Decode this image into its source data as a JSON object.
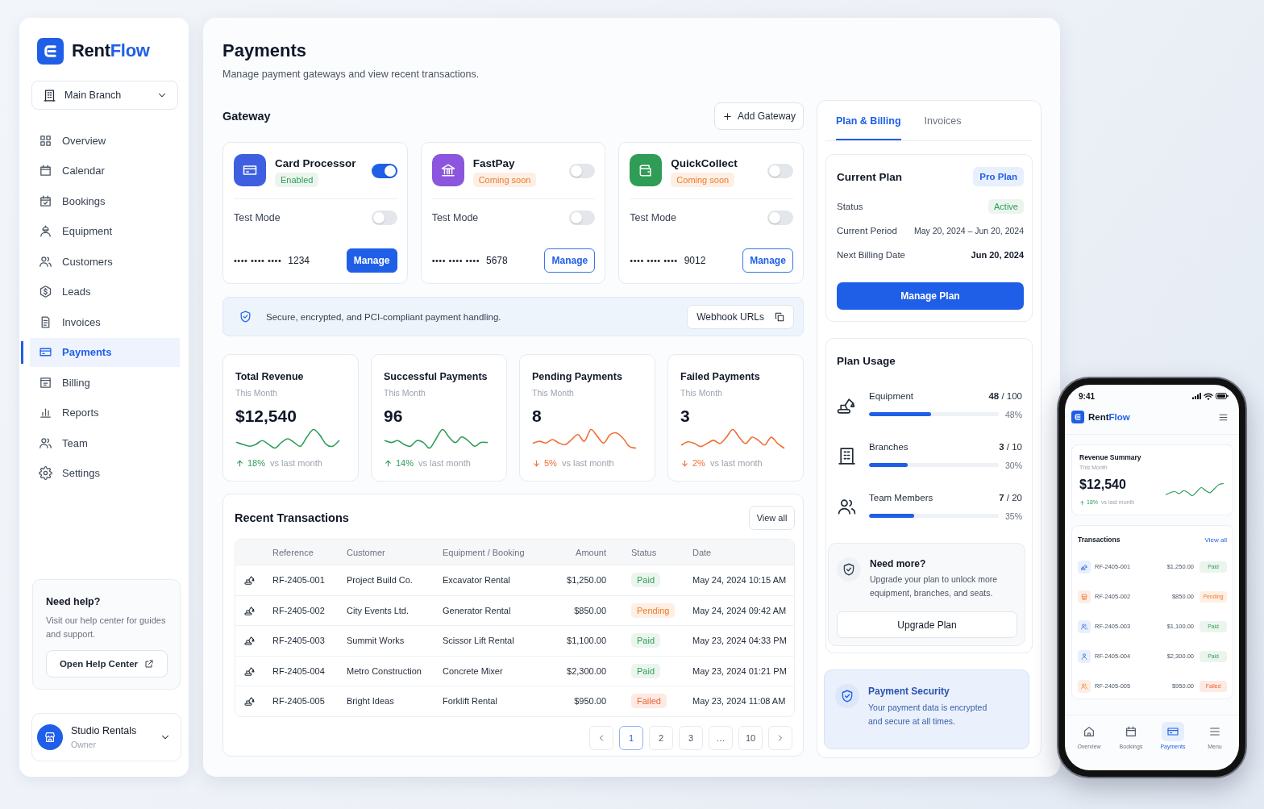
{
  "sidebar": {
    "brand": {
      "name": "Rent",
      "accent": "Flow"
    },
    "branch_selector": {
      "value": "Main Branch"
    },
    "nav": [
      {
        "label": "Overview",
        "selected": false
      },
      {
        "label": "Calendar",
        "selected": false
      },
      {
        "label": "Bookings",
        "selected": false
      },
      {
        "label": "Equipment",
        "selected": false
      },
      {
        "label": "Customers",
        "selected": false
      },
      {
        "label": "Leads",
        "selected": false
      },
      {
        "label": "Invoices",
        "selected": false
      },
      {
        "label": "Payments",
        "selected": true
      },
      {
        "label": "Billing",
        "selected": false
      },
      {
        "label": "Reports",
        "selected": false
      },
      {
        "label": "Team",
        "selected": false
      },
      {
        "label": "Settings",
        "selected": false
      }
    ],
    "help": {
      "title": "Need help?",
      "text": "Visit our help center for guides and support.",
      "button": "Open Help Center"
    },
    "profile": {
      "name": "Studio Rentals",
      "role": "Owner"
    }
  },
  "header": {
    "title": "Payments",
    "subtitle": "Manage payment gateways and view recent transactions."
  },
  "gateway": {
    "title": "Gateway",
    "add_button": "Add Gateway",
    "cards": [
      {
        "name": "Card Processor",
        "status": {
          "label": "Enabled",
          "kind": "enabled"
        },
        "color": "#3d5fe0",
        "on": true,
        "test_mode": {
          "label": "Test Mode",
          "on": false
        },
        "masked_number": "•••• •••• ••••",
        "last4": "1234",
        "button": "Manage"
      },
      {
        "name": "FastPay",
        "status": {
          "label": "Coming soon",
          "kind": "coming_soon"
        },
        "color": "#8b55dd",
        "on": false,
        "test_mode": {
          "label": "Test Mode",
          "on": false
        },
        "masked_number": "•••• •••• ••••",
        "last4": "5678",
        "button": "Manage"
      },
      {
        "name": "QuickCollect",
        "status": {
          "label": "Coming soon",
          "kind": "coming_soon"
        },
        "color": "#2f9d55",
        "on": false,
        "test_mode": {
          "label": "Test Mode",
          "on": false
        },
        "masked_number": "•••• •••• ••••",
        "last4": "9012",
        "button": "Manage"
      }
    ],
    "notice": {
      "text": "Secure, encrypted, and PCI-compliant payment handling.",
      "button": "Webhook URLs"
    }
  },
  "stats": [
    {
      "title": "Total Revenue",
      "period": "This Month",
      "value": "$12,540",
      "rising": true,
      "change": "18%",
      "note": "vs last month"
    },
    {
      "title": "Successful Payments",
      "period": "This Month",
      "value": "96",
      "rising": true,
      "change": "14%",
      "note": "vs last month"
    },
    {
      "title": "Pending Payments",
      "period": "This Month",
      "value": "8",
      "rising": false,
      "change": "5%",
      "note": "vs last month"
    },
    {
      "title": "Failed Payments",
      "period": "This Month",
      "value": "3",
      "rising": false,
      "change": "2%",
      "note": "vs last month"
    }
  ],
  "transactions": {
    "title": "Recent Transactions",
    "view_all": "View all",
    "columns": [
      "Reference",
      "Customer",
      "Equipment / Booking",
      "Amount",
      "Status",
      "Date"
    ],
    "rows": [
      {
        "reference": "RF-2405-001",
        "customer": "Project Build Co.",
        "booking": "Excavator Rental",
        "amount": "$1,250.00",
        "status": {
          "label": "Paid",
          "kind": "paid"
        },
        "date": "May 24, 2024 10:15 AM"
      },
      {
        "reference": "RF-2405-002",
        "customer": "City Events Ltd.",
        "booking": "Generator Rental",
        "amount": "$850.00",
        "status": {
          "label": "Pending",
          "kind": "pending"
        },
        "date": "May 24, 2024 09:42 AM"
      },
      {
        "reference": "RF-2405-003",
        "customer": "Summit Works",
        "booking": "Scissor Lift Rental",
        "amount": "$1,100.00",
        "status": {
          "label": "Paid",
          "kind": "paid"
        },
        "date": "May 23, 2024 04:33 PM"
      },
      {
        "reference": "RF-2405-004",
        "customer": "Metro Construction",
        "booking": "Concrete Mixer",
        "amount": "$2,300.00",
        "status": {
          "label": "Paid",
          "kind": "paid"
        },
        "date": "May 23, 2024 01:21 PM"
      },
      {
        "reference": "RF-2405-005",
        "customer": "Bright Ideas",
        "booking": "Forklift Rental",
        "amount": "$950.00",
        "status": {
          "label": "Failed",
          "kind": "failed"
        },
        "date": "May 23, 2024 11:08 AM"
      }
    ],
    "pagination": [
      {
        "label": "1",
        "selected": true
      },
      {
        "label": "2",
        "selected": false
      },
      {
        "label": "3",
        "selected": false
      },
      {
        "label": "…",
        "selected": false
      },
      {
        "label": "10",
        "selected": false
      }
    ]
  },
  "billing_panel": {
    "tabs": [
      {
        "label": "Plan & Billing",
        "selected": true
      },
      {
        "label": "Invoices",
        "selected": false
      }
    ],
    "current_plan": {
      "title": "Current Plan",
      "badge": "Pro Plan",
      "rows": [
        {
          "label": "Status",
          "value": "Active",
          "kind": "status"
        },
        {
          "label": "Current Period",
          "value": "May 20, 2024 – Jun 20, 2024",
          "kind": "text"
        },
        {
          "label": "Next Billing Date",
          "value": "Jun 20, 2024",
          "kind": "strong"
        }
      ],
      "button": "Manage Plan"
    },
    "usage": {
      "title": "Plan Usage",
      "items": [
        {
          "label": "Equipment",
          "count": "**48** / 100",
          "level": 0.48,
          "percent": "48%"
        },
        {
          "label": "Branches",
          "count": "**3** / 10",
          "level": 0.3,
          "percent": "30%"
        },
        {
          "label": "Team Members",
          "count": "**7** / 20",
          "level": 0.35,
          "percent": "35%"
        }
      ]
    },
    "upsell": {
      "title": "Need more?",
      "text": "Upgrade your plan to unlock more equipment, branches, and seats.",
      "button": "Upgrade Plan"
    },
    "security": {
      "title": "Payment Security",
      "text": "Your payment data is encrypted and secure at all times."
    }
  },
  "phone": {
    "time": "9:41",
    "brand": {
      "name": "Rent",
      "accent": "Flow"
    },
    "revenue": {
      "title": "Revenue Summary",
      "period": "This Month",
      "value": "$12,540",
      "rising": true,
      "change": "18%",
      "note": "vs last month"
    },
    "transactions": {
      "title": "Transactions",
      "view_all": "View all",
      "rows": [
        {
          "reference": "RF-2405-001",
          "amount": "$1,250.00",
          "status": {
            "label": "Paid",
            "kind": "paid"
          }
        },
        {
          "reference": "RF-2405-002",
          "amount": "$850.00",
          "status": {
            "label": "Pending",
            "kind": "pending"
          }
        },
        {
          "reference": "RF-2405-003",
          "amount": "$1,100.00",
          "status": {
            "label": "Paid",
            "kind": "paid"
          }
        },
        {
          "reference": "RF-2405-004",
          "amount": "$2,300.00",
          "status": {
            "label": "Paid",
            "kind": "paid"
          }
        },
        {
          "reference": "RF-2405-005",
          "amount": "$950.00",
          "status": {
            "label": "Failed",
            "kind": "failed"
          }
        }
      ]
    },
    "tabs": [
      {
        "label": "Overview",
        "selected": false
      },
      {
        "label": "Bookings",
        "selected": false
      },
      {
        "label": "Payments",
        "selected": true
      },
      {
        "label": "Menu",
        "selected": false
      }
    ]
  }
}
